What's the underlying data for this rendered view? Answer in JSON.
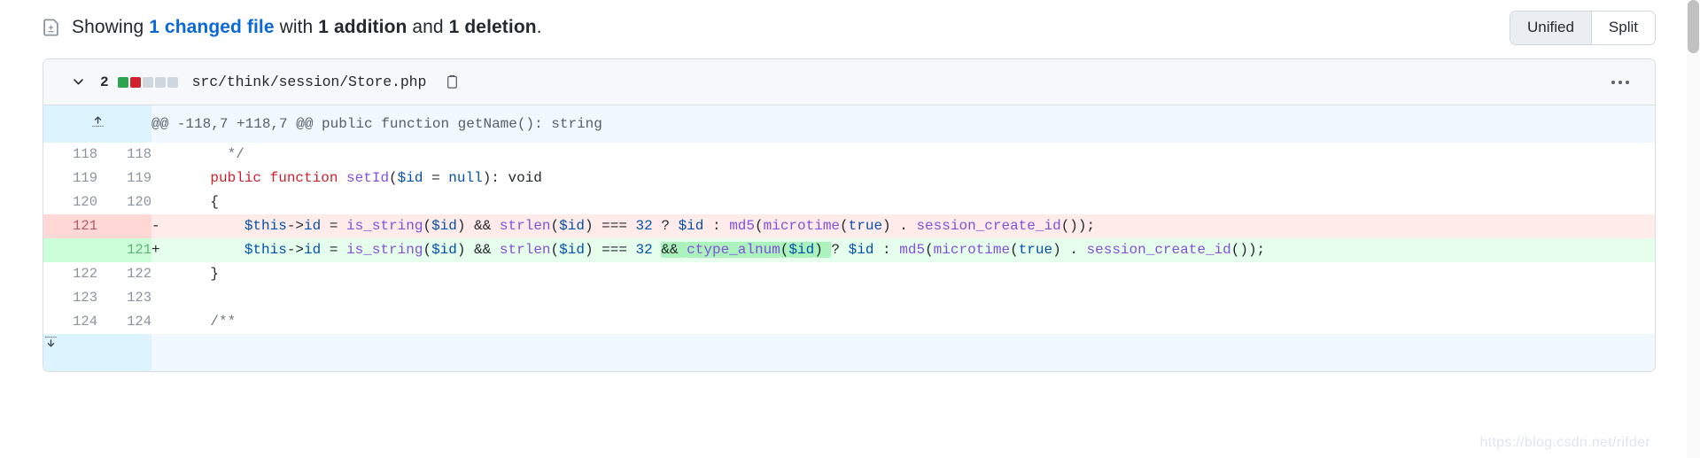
{
  "summary": {
    "icon": "diff-file-icon",
    "prefix": "Showing ",
    "changed_files_link": "1 changed file",
    "middle": " with ",
    "additions": "1 addition",
    "conjunction": " and ",
    "deletions": "1 deletion",
    "suffix": "."
  },
  "view_toggle": {
    "unified_label": "Unified",
    "split_label": "Split",
    "selected": "Unified"
  },
  "file": {
    "chevron_icon": "chevron-down-icon",
    "change_count": "2",
    "diffstat": {
      "blocks": [
        "#2da44e",
        "#cf222e",
        "#d0d7de",
        "#d0d7de",
        "#d0d7de"
      ],
      "added": 1,
      "deleted": 1,
      "total_boxes": 5
    },
    "path": "src/think/session/Store.php",
    "copy_icon": "copy-icon",
    "kebab_icon": "kebab-horizontal-icon"
  },
  "diff": {
    "hunk": {
      "expand_up_icon": "expand-up-icon",
      "header": "@@ -118,7 +118,7 @@ public function getName(): string"
    },
    "expand_down_icon": "expand-down-icon",
    "rows": [
      {
        "type": "context",
        "old_num": "118",
        "new_num": "118",
        "marker": "",
        "tokens": [
          {
            "t": "      ",
            "c": "tok-plain"
          },
          {
            "t": "*/",
            "c": "tok-cmt"
          }
        ]
      },
      {
        "type": "context",
        "old_num": "119",
        "new_num": "119",
        "marker": "",
        "tokens": [
          {
            "t": "    ",
            "c": "tok-plain"
          },
          {
            "t": "public function ",
            "c": "tok-kw"
          },
          {
            "t": "setId",
            "c": "tok-fn"
          },
          {
            "t": "(",
            "c": "tok-plain"
          },
          {
            "t": "$id",
            "c": "tok-var"
          },
          {
            "t": " = ",
            "c": "tok-plain"
          },
          {
            "t": "null",
            "c": "tok-const"
          },
          {
            "t": "): void",
            "c": "tok-plain"
          }
        ]
      },
      {
        "type": "context",
        "old_num": "120",
        "new_num": "120",
        "marker": "",
        "tokens": [
          {
            "t": "    {",
            "c": "tok-plain"
          }
        ]
      },
      {
        "type": "deletion",
        "old_num": "121",
        "new_num": "",
        "marker": "-",
        "tokens": [
          {
            "t": "        ",
            "c": "tok-plain"
          },
          {
            "t": "$this",
            "c": "tok-var"
          },
          {
            "t": "->",
            "c": "tok-plain"
          },
          {
            "t": "id",
            "c": "tok-var"
          },
          {
            "t": " = ",
            "c": "tok-plain"
          },
          {
            "t": "is_string",
            "c": "tok-fn"
          },
          {
            "t": "(",
            "c": "tok-plain"
          },
          {
            "t": "$id",
            "c": "tok-var"
          },
          {
            "t": ") && ",
            "c": "tok-plain"
          },
          {
            "t": "strlen",
            "c": "tok-fn"
          },
          {
            "t": "(",
            "c": "tok-plain"
          },
          {
            "t": "$id",
            "c": "tok-var"
          },
          {
            "t": ") === ",
            "c": "tok-plain"
          },
          {
            "t": "32",
            "c": "tok-num"
          },
          {
            "t": " ? ",
            "c": "tok-plain"
          },
          {
            "t": "$id",
            "c": "tok-var"
          },
          {
            "t": " : ",
            "c": "tok-plain"
          },
          {
            "t": "md5",
            "c": "tok-fn"
          },
          {
            "t": "(",
            "c": "tok-plain"
          },
          {
            "t": "microtime",
            "c": "tok-fn"
          },
          {
            "t": "(",
            "c": "tok-plain"
          },
          {
            "t": "true",
            "c": "tok-const"
          },
          {
            "t": ") . ",
            "c": "tok-plain"
          },
          {
            "t": "session_create_id",
            "c": "tok-fn"
          },
          {
            "t": "());",
            "c": "tok-plain"
          }
        ]
      },
      {
        "type": "addition",
        "old_num": "",
        "new_num": "121",
        "marker": "+",
        "tokens": [
          {
            "t": "        ",
            "c": "tok-plain"
          },
          {
            "t": "$this",
            "c": "tok-var"
          },
          {
            "t": "->",
            "c": "tok-plain"
          },
          {
            "t": "id",
            "c": "tok-var"
          },
          {
            "t": " = ",
            "c": "tok-plain"
          },
          {
            "t": "is_string",
            "c": "tok-fn"
          },
          {
            "t": "(",
            "c": "tok-plain"
          },
          {
            "t": "$id",
            "c": "tok-var"
          },
          {
            "t": ") && ",
            "c": "tok-plain"
          },
          {
            "t": "strlen",
            "c": "tok-fn"
          },
          {
            "t": "(",
            "c": "tok-plain"
          },
          {
            "t": "$id",
            "c": "tok-var"
          },
          {
            "t": ") === ",
            "c": "tok-plain"
          },
          {
            "t": "32",
            "c": "tok-num"
          },
          {
            "t": " ",
            "c": "tok-plain"
          },
          {
            "t": "&& ",
            "c": "tok-plain",
            "hl": true
          },
          {
            "t": "ctype_alnum",
            "c": "tok-fn",
            "hl": true
          },
          {
            "t": "(",
            "c": "tok-plain",
            "hl": true
          },
          {
            "t": "$id",
            "c": "tok-var",
            "hl": true
          },
          {
            "t": ") ",
            "c": "tok-plain",
            "hl": true
          },
          {
            "t": "? ",
            "c": "tok-plain"
          },
          {
            "t": "$id",
            "c": "tok-var"
          },
          {
            "t": " : ",
            "c": "tok-plain"
          },
          {
            "t": "md5",
            "c": "tok-fn"
          },
          {
            "t": "(",
            "c": "tok-plain"
          },
          {
            "t": "microtime",
            "c": "tok-fn"
          },
          {
            "t": "(",
            "c": "tok-plain"
          },
          {
            "t": "true",
            "c": "tok-const"
          },
          {
            "t": ") . ",
            "c": "tok-plain"
          },
          {
            "t": "session_create_id",
            "c": "tok-fn"
          },
          {
            "t": "());",
            "c": "tok-plain"
          }
        ]
      },
      {
        "type": "context",
        "old_num": "122",
        "new_num": "122",
        "marker": "",
        "tokens": [
          {
            "t": "    }",
            "c": "tok-plain"
          }
        ]
      },
      {
        "type": "context",
        "old_num": "123",
        "new_num": "123",
        "marker": "",
        "tokens": [
          {
            "t": "",
            "c": "tok-plain"
          }
        ]
      },
      {
        "type": "context",
        "old_num": "124",
        "new_num": "124",
        "marker": "",
        "tokens": [
          {
            "t": "    ",
            "c": "tok-plain"
          },
          {
            "t": "/**",
            "c": "tok-cmt"
          }
        ]
      }
    ]
  },
  "watermark": "https://blog.csdn.net/rifder"
}
